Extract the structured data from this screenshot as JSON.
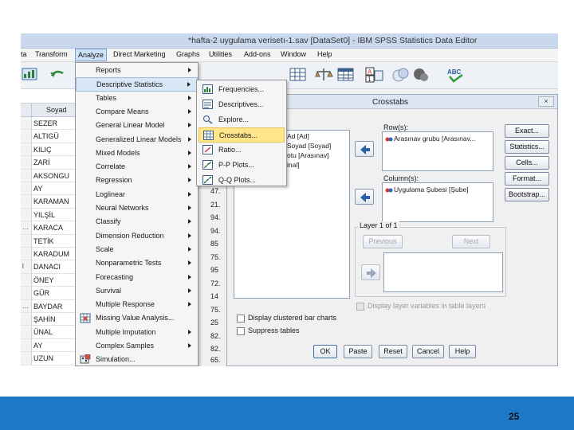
{
  "window": {
    "title": "*hafta-2 uygulama verisetı-1.sav [DataSet0] - IBM SPSS Statistics Data Editor"
  },
  "menubar": {
    "items": [
      {
        "label": "ta"
      },
      {
        "label": "Transform"
      },
      {
        "label": "Analyze"
      },
      {
        "label": "Direct Marketing"
      },
      {
        "label": "Graphs"
      },
      {
        "label": "Utilities"
      },
      {
        "label": "Add-ons"
      },
      {
        "label": "Window"
      },
      {
        "label": "Help"
      }
    ],
    "active_index": 2
  },
  "toolbar": {
    "icons": [
      "data-view-icon",
      "undo-icon",
      "data-grid-icon",
      "scale-icon",
      "table-icon",
      "value-label-icon",
      "circles-icon",
      "abc-icon"
    ]
  },
  "grid": {
    "column_header": "Soyad",
    "rows": [
      {
        "idx": "",
        "value": "SEZER"
      },
      {
        "idx": "",
        "value": "ALTIGÜ"
      },
      {
        "idx": "",
        "value": "KILIÇ"
      },
      {
        "idx": "",
        "value": "ZARİ"
      },
      {
        "idx": "",
        "value": "AKSONGU"
      },
      {
        "idx": "",
        "value": "AY"
      },
      {
        "idx": "",
        "value": "KARAMAN"
      },
      {
        "idx": "",
        "value": "YILŞİL"
      },
      {
        "idx": "…",
        "value": "KARACA"
      },
      {
        "idx": "",
        "value": "TETİK"
      },
      {
        "idx": "",
        "value": "KARADUM"
      },
      {
        "idx": "l",
        "value": "DANACI"
      },
      {
        "idx": "",
        "value": "ÖNEY"
      },
      {
        "idx": "",
        "value": "GÜR"
      },
      {
        "idx": "…",
        "value": "BAYDAR"
      },
      {
        "idx": "",
        "value": "ŞAHİN"
      },
      {
        "idx": "",
        "value": "ÜNAL"
      },
      {
        "idx": "",
        "value": "AY"
      },
      {
        "idx": "",
        "value": "UZUN"
      }
    ]
  },
  "analyze_menu": {
    "items": [
      {
        "label": "Reports",
        "submenu": true
      },
      {
        "label": "Descriptive Statistics",
        "submenu": true
      },
      {
        "label": "Tables",
        "submenu": true
      },
      {
        "label": "Compare Means",
        "submenu": true
      },
      {
        "label": "General Linear Model",
        "submenu": true
      },
      {
        "label": "Generalized Linear Models",
        "submenu": true
      },
      {
        "label": "Mixed Models",
        "submenu": true
      },
      {
        "label": "Correlate",
        "submenu": true
      },
      {
        "label": "Regression",
        "submenu": true
      },
      {
        "label": "Loglinear",
        "submenu": true
      },
      {
        "label": "Neural Networks",
        "submenu": true
      },
      {
        "label": "Classify",
        "submenu": true
      },
      {
        "label": "Dimension Reduction",
        "submenu": true
      },
      {
        "label": "Scale",
        "submenu": true
      },
      {
        "label": "Nonparametric Tests",
        "submenu": true
      },
      {
        "label": "Forecasting",
        "submenu": true
      },
      {
        "label": "Survival",
        "submenu": true
      },
      {
        "label": "Multiple Response",
        "submenu": true
      },
      {
        "label": "Missing Value Analysis...",
        "submenu": false
      },
      {
        "label": "Multiple Imputation",
        "submenu": true
      },
      {
        "label": "Complex Samples",
        "submenu": true
      },
      {
        "label": "Simulation...",
        "submenu": false
      }
    ],
    "highlighted_index": 1
  },
  "descriptive_submenu": {
    "items": [
      {
        "label": "Frequencies..."
      },
      {
        "label": "Descriptives..."
      },
      {
        "label": "Explore..."
      },
      {
        "label": "Crosstabs..."
      },
      {
        "label": "Ratio..."
      },
      {
        "label": "P-P Plots..."
      },
      {
        "label": "Q-Q Plots..."
      }
    ],
    "highlighted_index": 3
  },
  "background_numbers": [
    "47.",
    "21.",
    "94.",
    "94.",
    "85",
    "75.",
    "95",
    "72.",
    "14",
    "75.",
    "25",
    "82.",
    "82.",
    "65."
  ],
  "dialog": {
    "title": "Crosstabs",
    "close_label": "×",
    "source_list": [
      "Ad [Ad]",
      "Soyad [Soyad]",
      "otu [Arasınav]",
      "inal]"
    ],
    "rows_label": "Row(s):",
    "rows_items": [
      "Arasınav grubu [Arasınav..."
    ],
    "columns_label": "Column(s):",
    "columns_items": [
      "Uygulama Şubesi [Şube]"
    ],
    "layer_label": "Layer 1 of 1",
    "previous_label": "Previous",
    "next_label": "Next",
    "display_layer_label": "Display layer variables in table layers",
    "clustered_label": "Display clustered bar charts",
    "suppress_label": "Suppress tables",
    "side_buttons": [
      "Exact...",
      "Statistics...",
      "Cells...",
      "Format...",
      "Bootstrap..."
    ],
    "bottom_buttons": [
      "OK",
      "Paste",
      "Reset",
      "Cancel",
      "Help"
    ]
  },
  "colors": {
    "footer": "#1e78c8",
    "menu_highlight": "#ffe68a",
    "title_bar": "#c9d8ec"
  },
  "footer": {
    "page_number": "25"
  }
}
